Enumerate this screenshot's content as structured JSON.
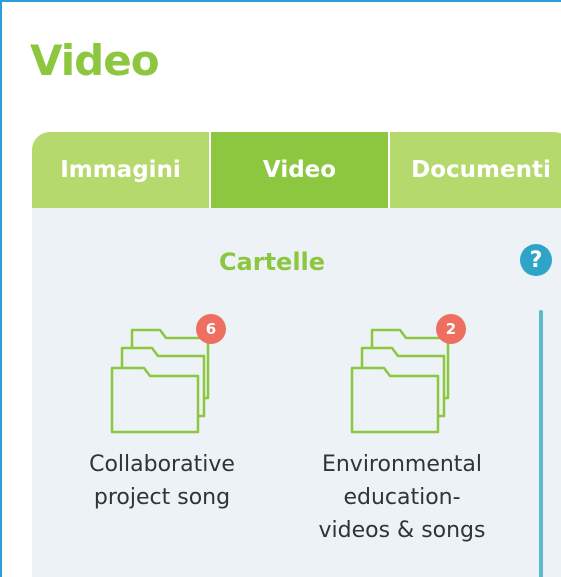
{
  "page": {
    "title": "Video"
  },
  "tabs": [
    {
      "label": "Immagini",
      "active": false
    },
    {
      "label": "Video",
      "active": true
    },
    {
      "label": "Documenti",
      "active": false
    }
  ],
  "folders_section": {
    "title": "Cartelle",
    "help_icon": "question-icon",
    "help_glyph": "?"
  },
  "folders": [
    {
      "name_line1": "Collaborative",
      "name_line2": "project song",
      "name_line3": "",
      "count": "6"
    },
    {
      "name_line1": "Environmental",
      "name_line2": "education-",
      "name_line3": "videos & songs",
      "count": "2"
    }
  ],
  "colors": {
    "accent_green": "#8dc63f",
    "tab_inactive": "#b6d96d",
    "badge": "#ee6e5f",
    "help": "#2fa4c9",
    "panel_bg": "#ecf2f6"
  }
}
